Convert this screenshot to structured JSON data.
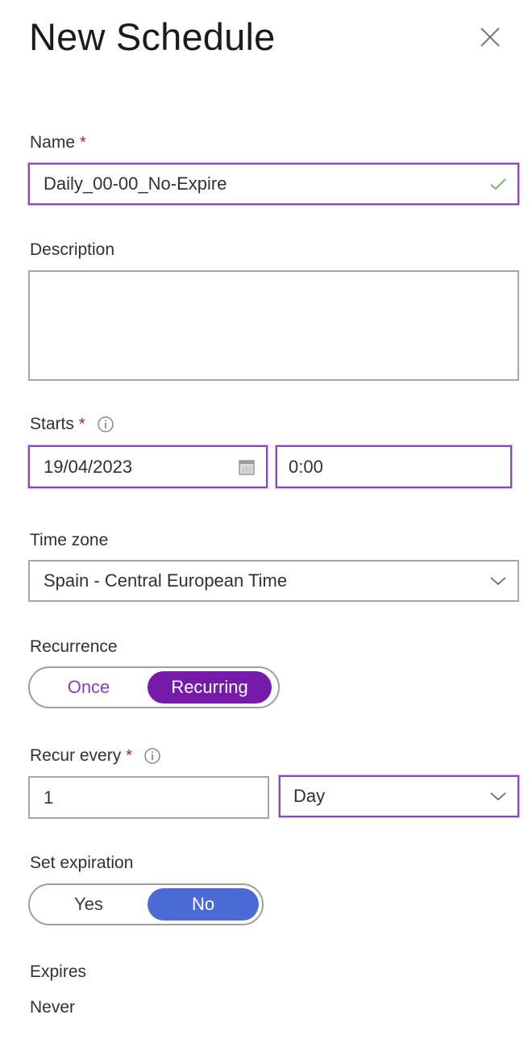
{
  "header": {
    "title": "New Schedule",
    "close_icon": "close-icon"
  },
  "form": {
    "name": {
      "label": "Name",
      "required_mark": "*",
      "value": "Daily_00-00_No-Expire",
      "status_icon": "checkmark-icon"
    },
    "description": {
      "label": "Description",
      "value": ""
    },
    "starts": {
      "label": "Starts",
      "required_mark": "*",
      "info_icon": "info-icon",
      "date_value": "19/04/2023",
      "date_icon": "calendar-icon",
      "time_value": "0:00"
    },
    "time_zone": {
      "label": "Time zone",
      "selected": "Spain - Central European Time",
      "chevron_icon": "chevron-down-icon"
    },
    "recurrence": {
      "label": "Recurrence",
      "options": [
        "Once",
        "Recurring"
      ],
      "selected": "Recurring",
      "accent_color": "#7719aa"
    },
    "recur_every": {
      "label": "Recur every",
      "required_mark": "*",
      "info_icon": "info-icon",
      "interval_value": "1",
      "unit_selected": "Day",
      "chevron_icon": "chevron-down-icon"
    },
    "set_expiration": {
      "label": "Set expiration",
      "options": [
        "Yes",
        "No"
      ],
      "selected": "No",
      "accent_color": "#4a6bd6"
    },
    "expires": {
      "label": "Expires",
      "value": "Never"
    }
  },
  "colors": {
    "focus_border": "#8c48b8",
    "required": "#a4262c",
    "valid_check": "#7bb661",
    "recurrence_accent": "#7719aa",
    "expiration_accent": "#4a6bd6"
  }
}
